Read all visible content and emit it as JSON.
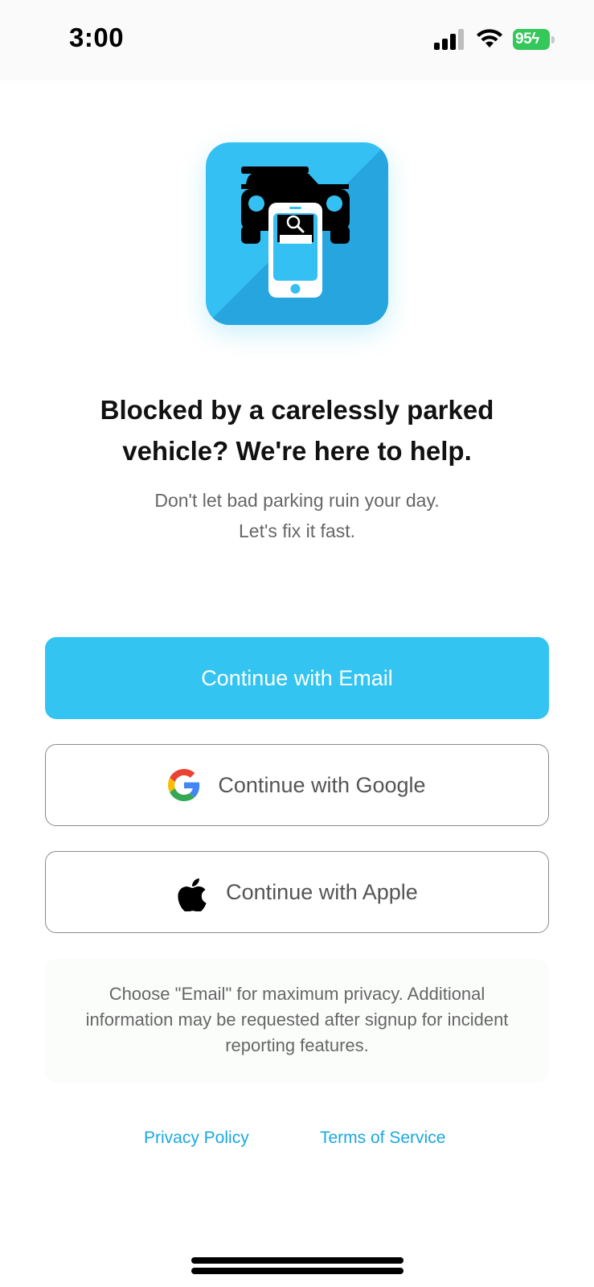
{
  "status_bar": {
    "time": "3:00",
    "battery_level": "95"
  },
  "hero": {
    "icon": "car-phone-search-icon",
    "headline": "Blocked by a carelessly parked vehicle? We're here to help.",
    "subhead_line1": "Don't let bad parking ruin your day.",
    "subhead_line2": "Let's fix it fast."
  },
  "auth": {
    "email_label": "Continue with Email",
    "google_label": "Continue with Google",
    "apple_label": "Continue with Apple"
  },
  "note": {
    "text": "Choose \"Email\" for maximum privacy. Additional information may be requested after signup for incident reporting features."
  },
  "footer": {
    "privacy_label": "Privacy Policy",
    "terms_label": "Terms of Service"
  },
  "colors": {
    "accent": "#34c4f2",
    "link": "#1aa8e0",
    "battery": "#34c759"
  }
}
